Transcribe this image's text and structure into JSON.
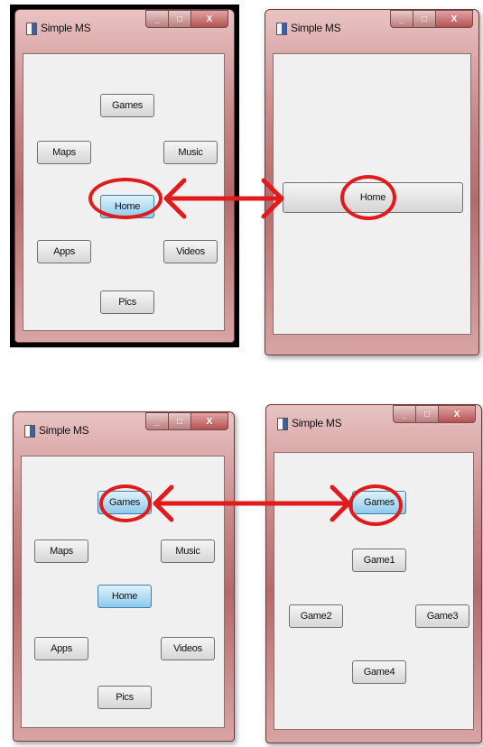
{
  "window_title": "Simple MS",
  "controls": {
    "minimize": "_",
    "maximize": "□",
    "close": "X"
  },
  "menu_buttons": {
    "games": "Games",
    "maps": "Maps",
    "music": "Music",
    "home": "Home",
    "apps": "Apps",
    "videos": "Videos",
    "pics": "Pics"
  },
  "games_buttons": {
    "games": "Games",
    "game1": "Game1",
    "game2": "Game2",
    "game3": "Game3",
    "game4": "Game4"
  },
  "colors": {
    "annotation": "#e11b1b",
    "highlight": "#8ec8ea",
    "frame": "#b56a6a"
  }
}
